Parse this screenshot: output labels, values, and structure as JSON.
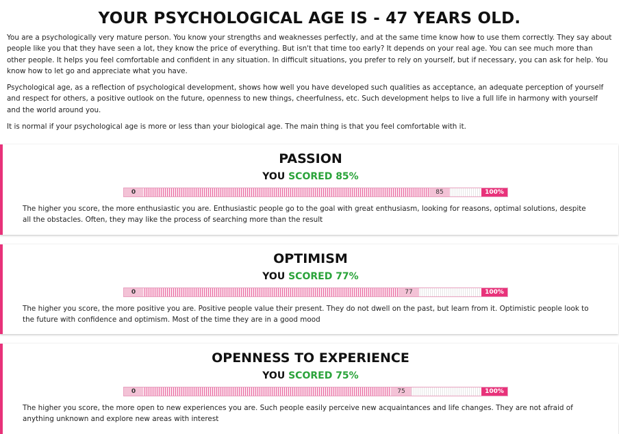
{
  "headline": "YOUR PSYCHOLOGICAL AGE IS - 47 YEARS OLD.",
  "intro": [
    "You are a psychologically very mature person. You know your strengths and weaknesses perfectly, and at the same time know how to use them correctly. They say about people like you that they have seen a lot, they know the price of everything. But isn't that time too early? It depends on your real age. You can see much more than other people. It helps you feel comfortable and confident in any situation. In difficult situations, you prefer to rely on yourself, but if necessary, you can ask for help. You know how to let go and appreciate what you have.",
    "Psychological age, as a reflection of psychological development, shows how well you have developed such qualities as acceptance, an adequate perception of yourself and respect for others, a positive outlook on the future, openness to new things, cheerfulness, etc. Such development helps to live a full life in harmony with yourself and the world around you.",
    "It is normal if your psychological age is more or less than your biological age. The main thing is that you feel comfortable with it."
  ],
  "colors": {
    "accent": "#e8327a",
    "scored": "#2aa33a"
  },
  "cards": [
    {
      "title": "PASSION",
      "score_prefix": "YOU",
      "score_word": "SCORED 85%",
      "score": 85,
      "min_label": "0",
      "value_label": "85",
      "max_label": "100%",
      "description": "The higher you score, the more enthusiastic you are. Enthusiastic people go to the goal with great enthusiasm, looking for reasons, optimal solutions, despite all the obstacles. Often, they may like the process of searching more than the result"
    },
    {
      "title": "OPTIMISM",
      "score_prefix": "YOU",
      "score_word": "SCORED 77%",
      "score": 77,
      "min_label": "0",
      "value_label": "77",
      "max_label": "100%",
      "description": "The higher you score, the more positive you are. Positive people value their present. They do not dwell on the past, but learn from it. Optimistic people look to the future with confidence and optimism. Most of the time they are in a good mood"
    },
    {
      "title": "OPENNESS TO EXPERIENCE",
      "score_prefix": "YOU",
      "score_word": "SCORED 75%",
      "score": 75,
      "min_label": "0",
      "value_label": "75",
      "max_label": "100%",
      "description": "The higher you score, the more open to new experiences you are. Such people easily perceive new acquaintances and life changes. They are not afraid of anything unknown and explore new areas with interest"
    }
  ]
}
